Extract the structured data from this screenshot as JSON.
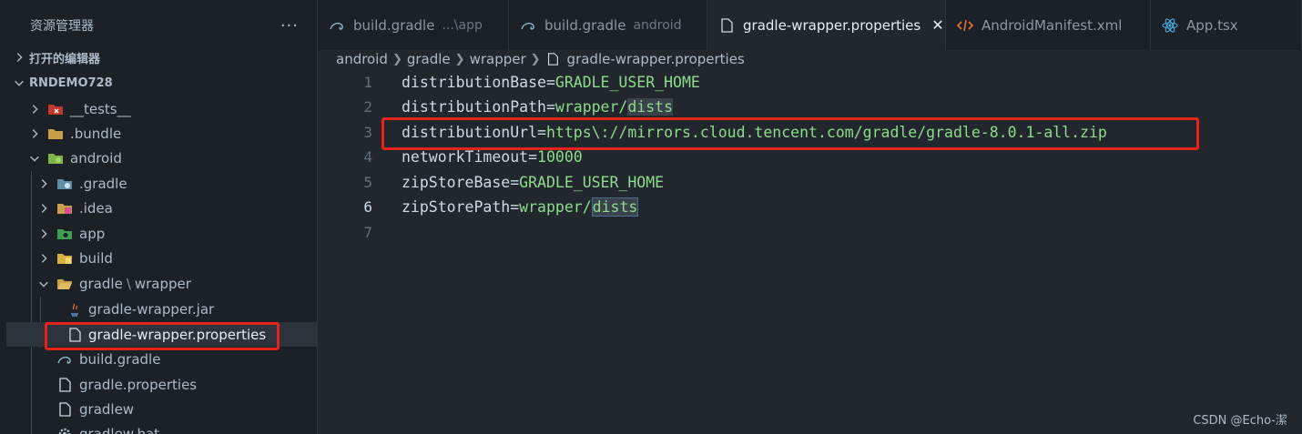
{
  "explorer": {
    "title": "资源管理器",
    "more": "···",
    "open_editors": "打开的编辑器",
    "project": "RNDEMO728",
    "tree": [
      {
        "label": "__tests__",
        "chevron": "right",
        "icon": "tests-folder-icon"
      },
      {
        "label": ".bundle",
        "chevron": "right",
        "icon": "folder-icon"
      },
      {
        "label": "android",
        "chevron": "down",
        "icon": "android-folder-icon"
      },
      {
        "label": ".gradle",
        "chevron": "right",
        "icon": "gradle-folder-icon"
      },
      {
        "label": ".idea",
        "chevron": "right",
        "icon": "idea-folder-icon"
      },
      {
        "label": "app",
        "chevron": "right",
        "icon": "app-folder-icon"
      },
      {
        "label": "build",
        "chevron": "right",
        "icon": "build-folder-icon"
      },
      {
        "label": "gradle",
        "label_suffix": "wrapper",
        "chevron": "down",
        "icon": "open-folder-icon"
      },
      {
        "label": "gradle-wrapper.jar",
        "icon": "java-icon"
      },
      {
        "label": "gradle-wrapper.properties",
        "icon": "file-icon"
      },
      {
        "label": "build.gradle",
        "icon": "gradle-file-icon"
      },
      {
        "label": "gradle.properties",
        "icon": "file-icon"
      },
      {
        "label": "gradlew",
        "icon": "file-icon"
      },
      {
        "label": "gradlew.bat",
        "icon": "gear-icon"
      }
    ]
  },
  "tabs": [
    {
      "label": "build.gradle",
      "desc": "...\\app",
      "icon": "gradle-file-icon"
    },
    {
      "label": "build.gradle",
      "desc": "android",
      "icon": "gradle-file-icon"
    },
    {
      "label": "gradle-wrapper.properties",
      "desc": "",
      "icon": "file-icon",
      "active": true,
      "close": "✕"
    },
    {
      "label": "AndroidManifest.xml",
      "desc": "",
      "icon": "xml-icon"
    },
    {
      "label": "App.tsx",
      "desc": "",
      "icon": "react-icon"
    }
  ],
  "breadcrumb": [
    "android",
    "gradle",
    "wrapper",
    "gradle-wrapper.properties"
  ],
  "editor": {
    "lines": [
      {
        "num": "1",
        "key": "distributionBase",
        "value": "GRADLE_USER_HOME"
      },
      {
        "num": "2",
        "key": "distributionPath",
        "value_a": "wrapper/",
        "value_b": "dists"
      },
      {
        "num": "3",
        "key": "distributionUrl",
        "value": "https\\://mirrors.cloud.tencent.com/gradle/gradle-8.0.1-all.zip"
      },
      {
        "num": "4",
        "key": "networkTimeout",
        "value": "10000"
      },
      {
        "num": "5",
        "key": "zipStoreBase",
        "value": "GRADLE_USER_HOME"
      },
      {
        "num": "6",
        "key": "zipStorePath",
        "value_a": "wrapper/",
        "value_b": "dists"
      },
      {
        "num": "7"
      }
    ],
    "current_line": "6"
  },
  "watermark": "CSDN @Echo-潔",
  "colors": {
    "highlight": "#e5231b",
    "value": "#8ddb8c",
    "key": "#cdd9e5"
  }
}
